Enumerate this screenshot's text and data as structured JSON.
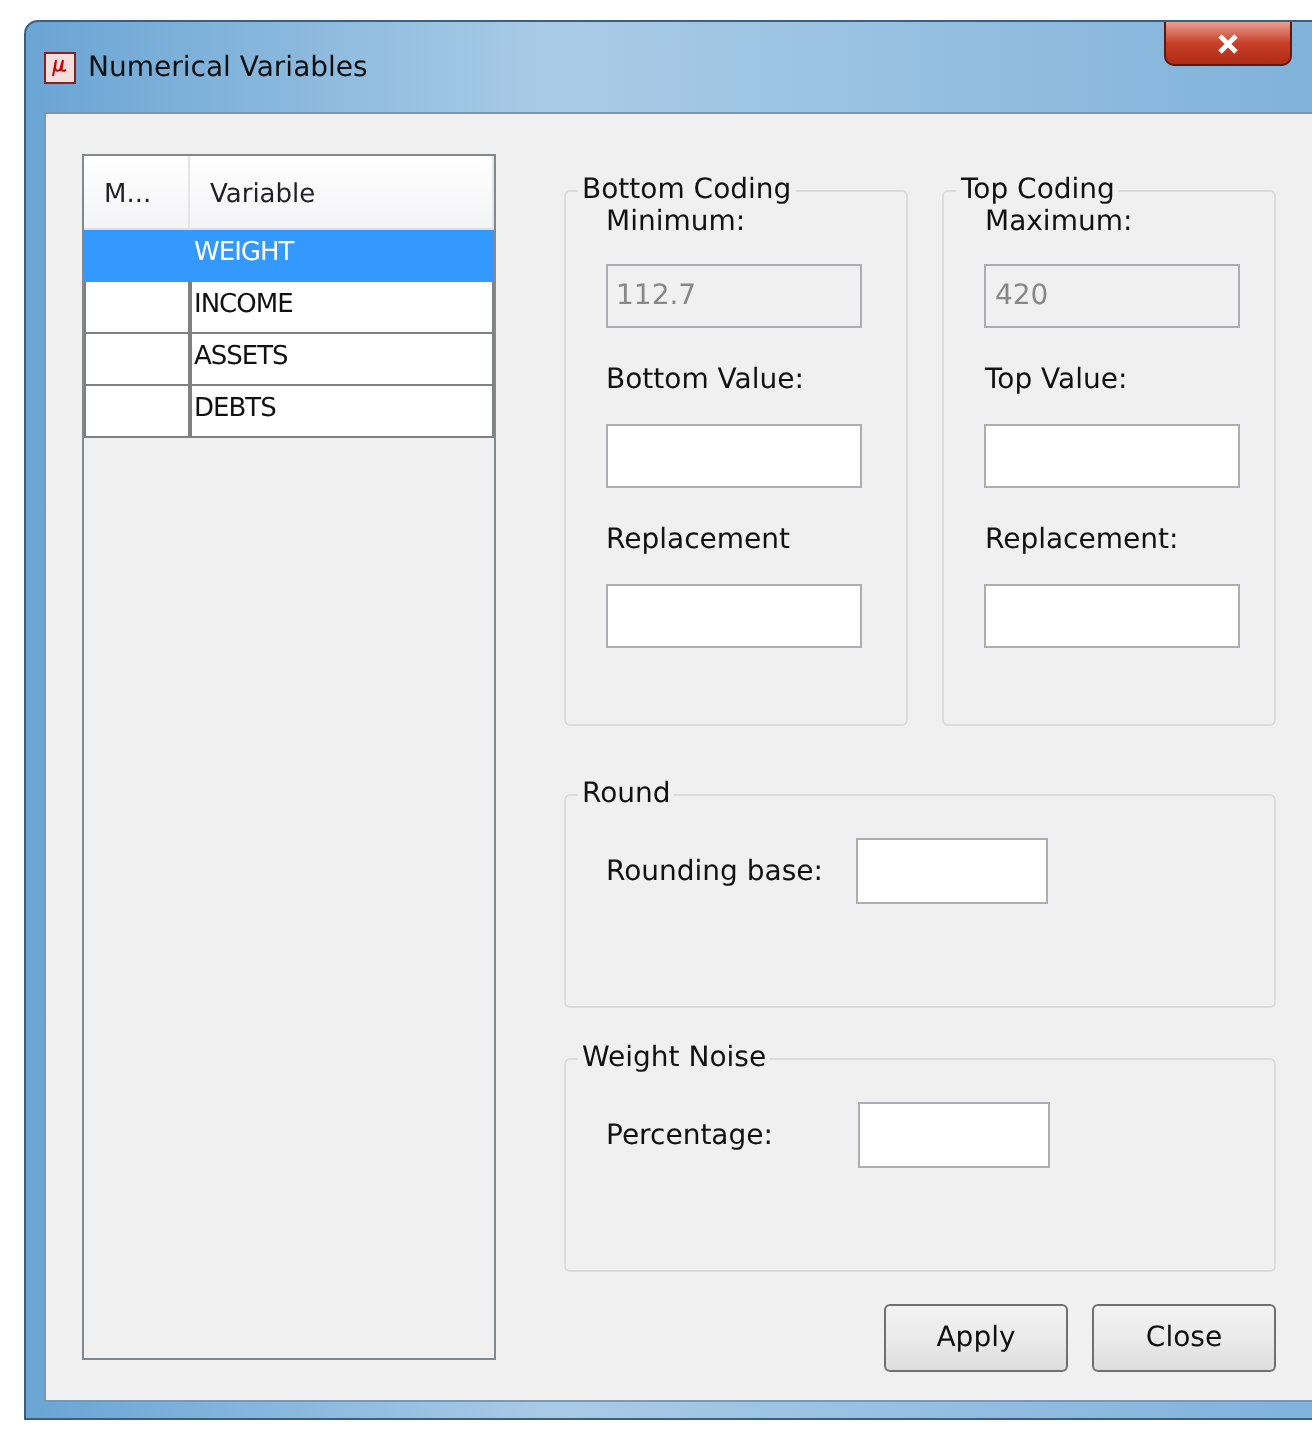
{
  "window": {
    "title": "Numerical Variables"
  },
  "table": {
    "columns": [
      "M...",
      "Variable"
    ],
    "rows": [
      {
        "variable": "WEIGHT",
        "selected": true
      },
      {
        "variable": "INCOME",
        "selected": false
      },
      {
        "variable": "ASSETS",
        "selected": false
      },
      {
        "variable": "DEBTS",
        "selected": false
      }
    ]
  },
  "coding_groups": [
    {
      "title": "Bottom Coding",
      "fields": [
        {
          "label": "Minimum:",
          "value": "112.7",
          "disabled": true
        },
        {
          "label": "Bottom Value:",
          "disabled": false
        },
        {
          "label": "Replacement",
          "disabled": false
        }
      ]
    },
    {
      "title": "Top Coding",
      "fields": [
        {
          "label": "Maximum:",
          "value": "420",
          "disabled": true
        },
        {
          "label": "Top Value:",
          "disabled": false
        },
        {
          "label": "Replacement:",
          "disabled": false
        }
      ]
    }
  ],
  "round": {
    "title": "Round",
    "label": "Rounding base:"
  },
  "weight_noise": {
    "title": "Weight Noise",
    "label": "Percentage:"
  },
  "buttons": [
    "Apply",
    "Close"
  ]
}
